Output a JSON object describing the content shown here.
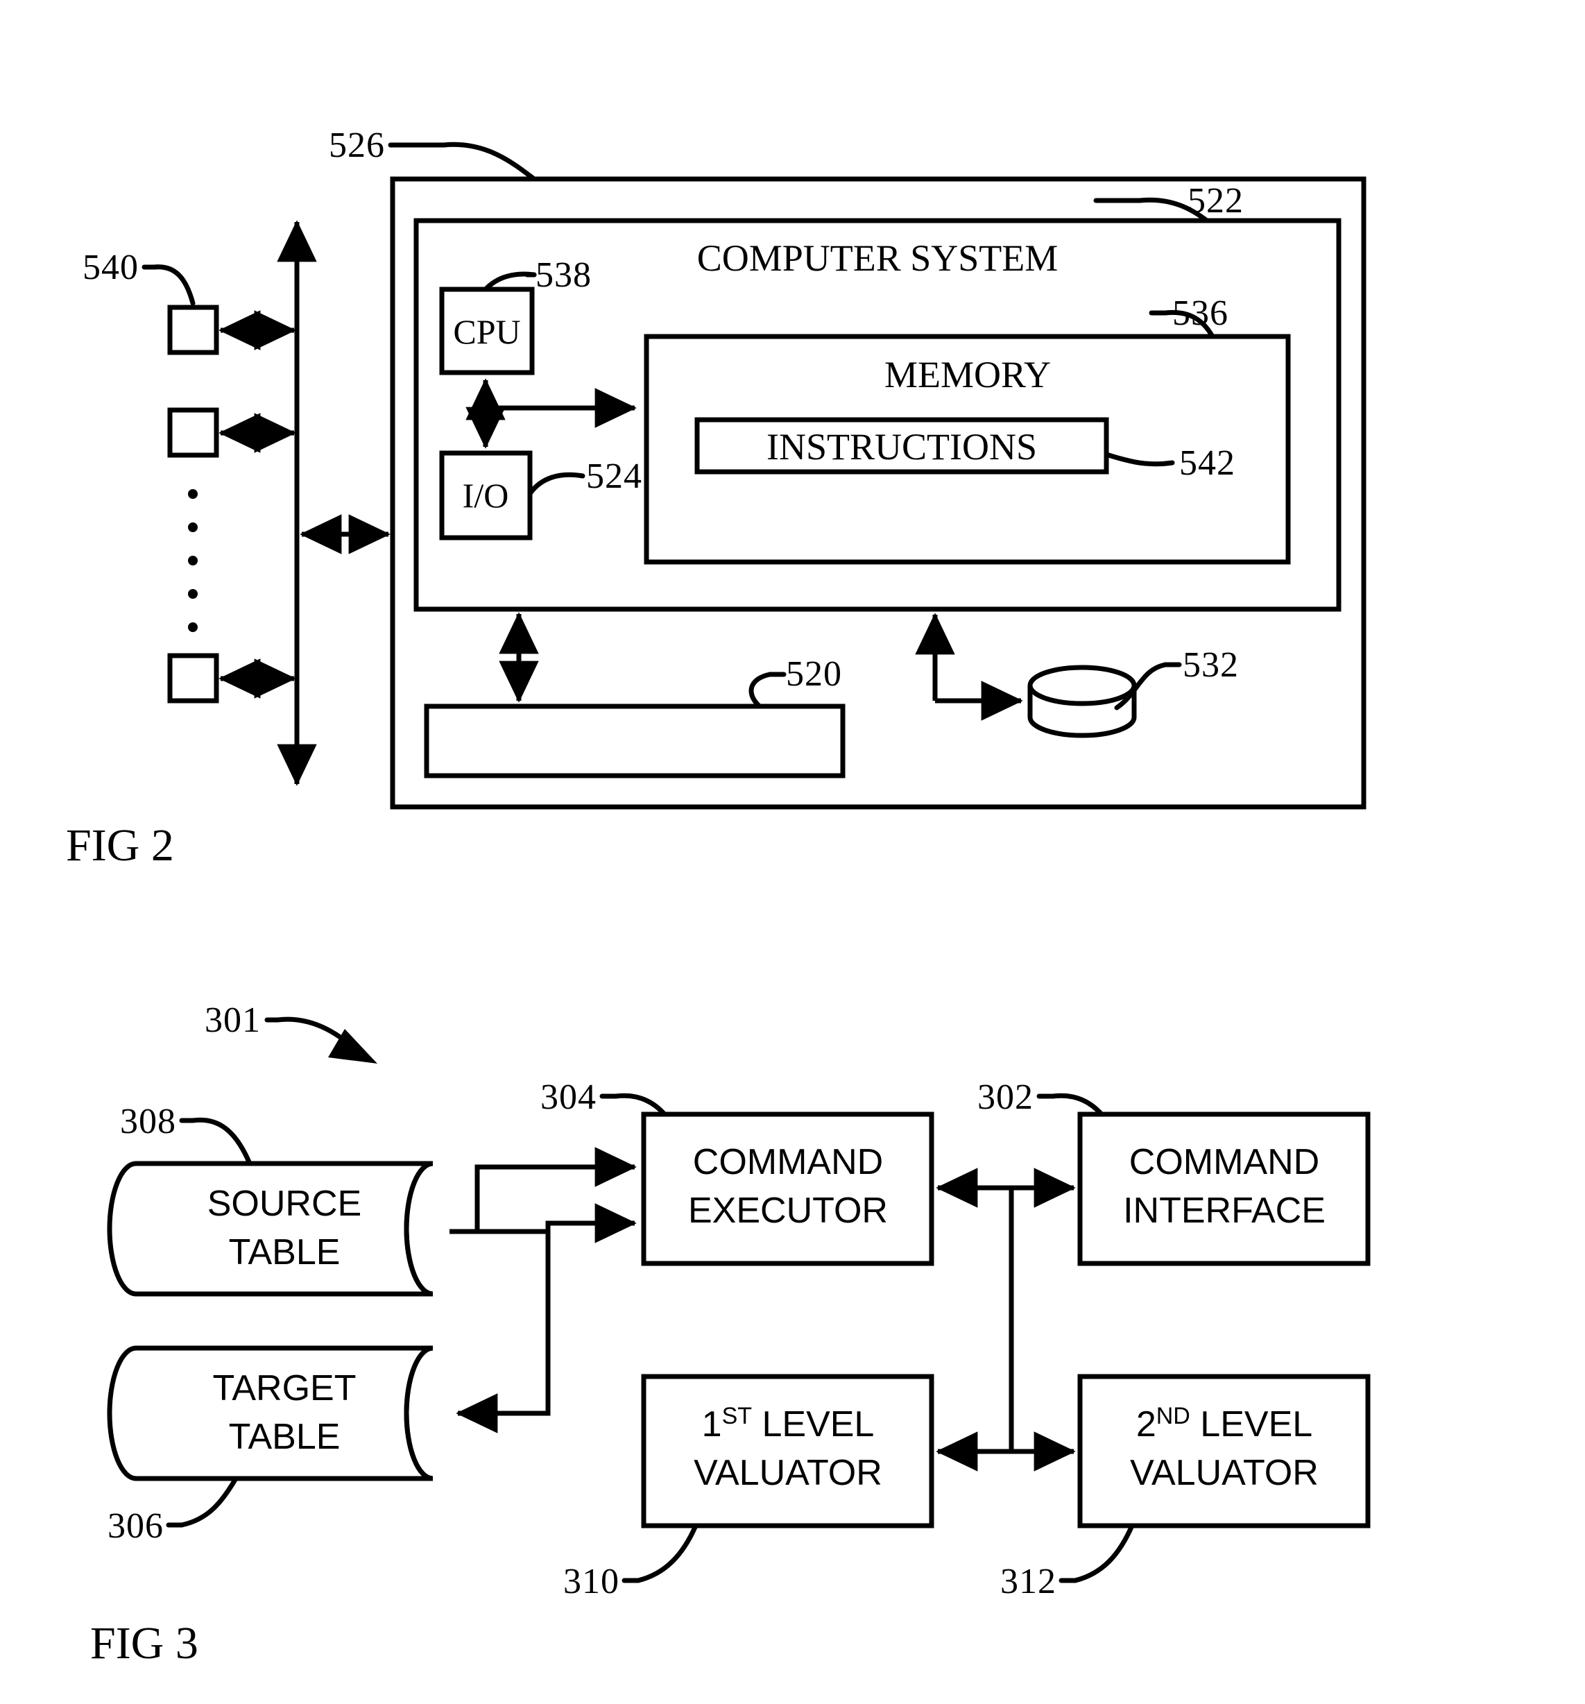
{
  "figures": [
    {
      "id": "fig2",
      "caption": "FIG 2",
      "outer_ref": "526",
      "inner_ref": "522",
      "inner_title": "COMPUTER SYSTEM",
      "blocks": {
        "cpu": {
          "label": "CPU",
          "ref": "538"
        },
        "io": {
          "label": "I/O",
          "ref": "524"
        },
        "memory": {
          "label": "MEMORY",
          "ref": "536"
        },
        "instructions": {
          "label": "INSTRUCTIONS",
          "ref": "542"
        },
        "bus_device": {
          "label": "",
          "ref": "520"
        },
        "storage": {
          "label": "",
          "ref": "532"
        },
        "peripherals": {
          "label": "",
          "ref": "540"
        }
      }
    },
    {
      "id": "fig3",
      "caption": "FIG 3",
      "system_ref": "301",
      "blocks": {
        "source_table": {
          "line1": "SOURCE",
          "line2": "TABLE",
          "ref": "308"
        },
        "target_table": {
          "line1": "TARGET",
          "line2": "TABLE",
          "ref": "306"
        },
        "command_executor": {
          "line1": "COMMAND",
          "line2": "EXECUTOR",
          "ref": "304"
        },
        "command_interface": {
          "line1": "COMMAND",
          "line2": "INTERFACE",
          "ref": "302"
        },
        "first_level_valuator": {
          "line1_num": "1",
          "line1_sup": "ST",
          "line1_rest": " LEVEL",
          "line2": "VALUATOR",
          "ref": "310"
        },
        "second_level_valuator": {
          "line1_num": "2",
          "line1_sup": "ND",
          "line1_rest": " LEVEL",
          "line2": "VALUATOR",
          "ref": "312"
        }
      }
    }
  ],
  "colors": {
    "ink": "#000000",
    "paper": "#ffffff"
  }
}
